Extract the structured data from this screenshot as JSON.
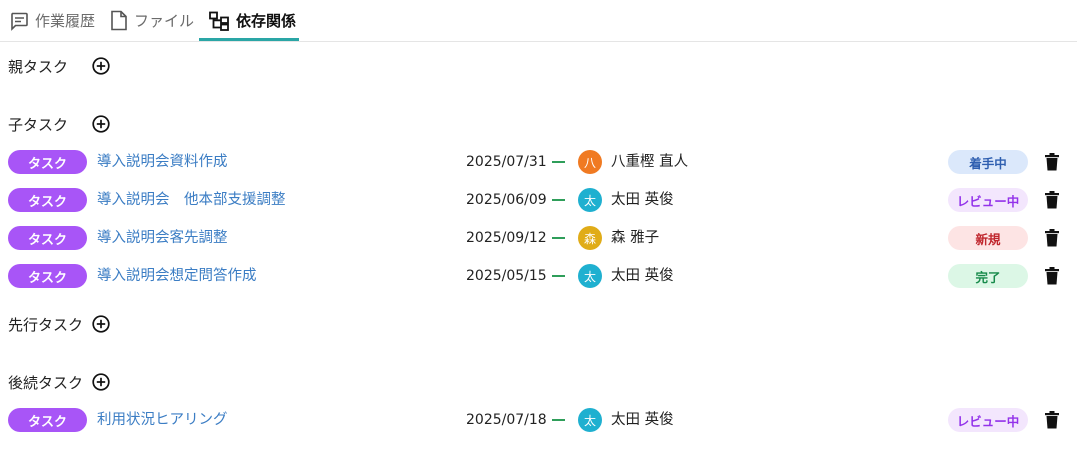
{
  "tabs": [
    {
      "label": "作業履歴",
      "icon": "comment-icon",
      "active": false
    },
    {
      "label": "ファイル",
      "icon": "file-icon",
      "active": false
    },
    {
      "label": "依存関係",
      "icon": "hierarchy-icon",
      "active": true
    }
  ],
  "sections": {
    "parent": {
      "title": "親タスク",
      "rows": []
    },
    "children": {
      "title": "子タスク",
      "rows": [
        {
          "type": "タスク",
          "title": "導入説明会資料作成",
          "due": "2025/07/31",
          "avatar": "八",
          "avatar_color": "#f07a22",
          "assignee": "八重樫 直人",
          "status": "着手中",
          "status_style": "in-progress"
        },
        {
          "type": "タスク",
          "title": "導入説明会　他本部支援調整",
          "due": "2025/06/09",
          "avatar": "太",
          "avatar_color": "#1fb0d0",
          "assignee": "太田 英俊",
          "status": "レビュー中",
          "status_style": "review"
        },
        {
          "type": "タスク",
          "title": "導入説明会客先調整",
          "due": "2025/09/12",
          "avatar": "森",
          "avatar_color": "#e0ac18",
          "assignee": "森 雅子",
          "status": "新規",
          "status_style": "new"
        },
        {
          "type": "タスク",
          "title": "導入説明会想定問答作成",
          "due": "2025/05/15",
          "avatar": "太",
          "avatar_color": "#1fb0d0",
          "assignee": "太田 英俊",
          "status": "完了",
          "status_style": "done"
        }
      ]
    },
    "predecessors": {
      "title": "先行タスク",
      "rows": []
    },
    "successors": {
      "title": "後続タスク",
      "rows": [
        {
          "type": "タスク",
          "title": "利用状況ヒアリング",
          "due": "2025/07/18",
          "avatar": "太",
          "avatar_color": "#1fb0d0",
          "assignee": "太田 英俊",
          "status": "レビュー中",
          "status_style": "review"
        }
      ]
    }
  },
  "status_colors": {
    "in-progress": {
      "bg": "#dbe8fb",
      "fg": "#2f5fb0"
    },
    "review": {
      "bg": "#f3e6fd",
      "fg": "#9333ea"
    },
    "new": {
      "bg": "#fde4e4",
      "fg": "#c0262d"
    },
    "done": {
      "bg": "#dcf7e6",
      "fg": "#168a4a"
    }
  },
  "accent": "#2aa6a6",
  "type_pill_color": "#a855f7"
}
